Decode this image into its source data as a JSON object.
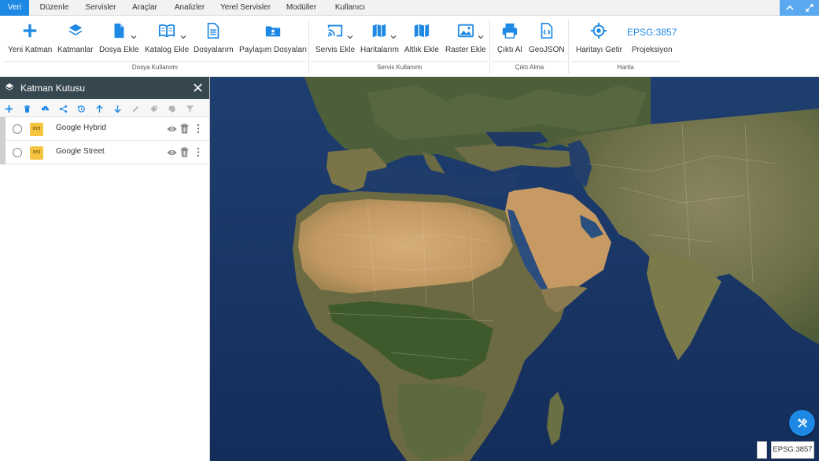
{
  "tabs": [
    {
      "label": "Veri",
      "active": true
    },
    {
      "label": "Düzenle"
    },
    {
      "label": "Servisler"
    },
    {
      "label": "Araçlar"
    },
    {
      "label": "Analizler"
    },
    {
      "label": "Yerel Servisler"
    },
    {
      "label": "Modüller"
    },
    {
      "label": "Kullanıcı"
    }
  ],
  "window_buttons": [
    {
      "icon": "chevron-up-icon"
    },
    {
      "icon": "expand-icon"
    }
  ],
  "ribbon": {
    "groups": [
      {
        "label": "Dosya Kullanımı",
        "items": [
          {
            "label": "Yeni Katman",
            "icon": "plus-icon"
          },
          {
            "label": "Katmanlar",
            "icon": "layers-icon"
          },
          {
            "label": "Dosya Ekle",
            "icon": "file-icon",
            "dropdown": true
          },
          {
            "label": "Katalog Ekle",
            "icon": "book-icon",
            "dropdown": true
          },
          {
            "label": "Dosyalarım",
            "icon": "document-icon"
          },
          {
            "label": "Paylaşım Dosyaları",
            "icon": "shared-folder-icon"
          }
        ]
      },
      {
        "label": "Servis Kullanımı",
        "items": [
          {
            "label": "Servis Ekle",
            "icon": "cast-icon",
            "dropdown": true
          },
          {
            "label": "Haritalarım",
            "icon": "map-icon",
            "dropdown": true
          },
          {
            "label": "Altlık Ekle",
            "icon": "basemap-icon"
          },
          {
            "label": "Raster Ekle",
            "icon": "image-icon",
            "dropdown": true
          }
        ]
      },
      {
        "label": "Çıktı Alma",
        "items": [
          {
            "label": "Çıktı Al",
            "icon": "printer-icon"
          },
          {
            "label": "GeoJSON",
            "icon": "code-file-icon"
          }
        ]
      },
      {
        "label": "Harita",
        "items": [
          {
            "label": "Haritayı Getir",
            "icon": "crosshair-icon"
          },
          {
            "label": "Projeksiyon",
            "text": "EPSG:3857"
          }
        ]
      }
    ]
  },
  "layer_panel": {
    "title": "Katman Kutusu",
    "toolbar": [
      {
        "icon": "plus-icon",
        "enabled": true
      },
      {
        "icon": "trash-icon",
        "enabled": true
      },
      {
        "icon": "cloud-download-icon",
        "enabled": true
      },
      {
        "icon": "share-icon",
        "enabled": true
      },
      {
        "icon": "history-icon",
        "enabled": true
      },
      {
        "icon": "arrow-up-icon",
        "enabled": true
      },
      {
        "icon": "arrow-down-icon",
        "enabled": true
      },
      {
        "icon": "pencil-icon",
        "enabled": false
      },
      {
        "icon": "tag-icon",
        "enabled": false
      },
      {
        "icon": "paint-icon",
        "enabled": false
      },
      {
        "icon": "filter-icon",
        "enabled": false
      }
    ],
    "layers": [
      {
        "name": "Google Hybrid",
        "type": "XYZ"
      },
      {
        "name": "Google Street",
        "type": "XYZ"
      }
    ]
  },
  "map": {
    "projection_badge": "EPSG:3857",
    "fab_icon": "tools-icon"
  },
  "colors": {
    "accent": "#1e88e5",
    "panel_header": "#37474f",
    "ocean": "#1d3a6b",
    "desert": "#c9a06a",
    "vegetation": "#4a6a3a"
  }
}
